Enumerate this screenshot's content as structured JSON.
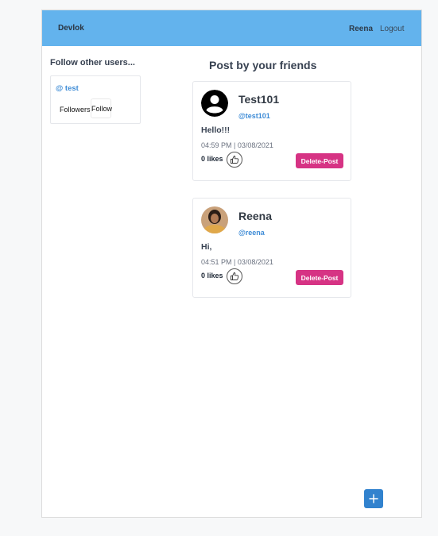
{
  "navbar": {
    "brand": "Devlok",
    "user": "Reena",
    "logout": "Logout",
    "color": "#63b3ed"
  },
  "sidebar": {
    "title": "Follow other users...",
    "suggestions": [
      {
        "handle": "@ test",
        "followers_label": "Followers",
        "follow_label": "Follow"
      }
    ]
  },
  "feed": {
    "title": "Post by your friends",
    "posts": [
      {
        "name": "Test101",
        "handle": "@test101",
        "text": "Hello!!!",
        "time": "04:59 PM | 03/08/2021",
        "likes": "0 likes",
        "delete_label": "Delete-Post",
        "avatar": "default-user-icon"
      },
      {
        "name": "Reena",
        "handle": "@reena",
        "text": "Hi,",
        "time": "04:51 PM | 03/08/2021",
        "likes": "0 likes",
        "delete_label": "Delete-Post",
        "avatar": "user-photo"
      }
    ]
  },
  "fab": {
    "icon": "plus-icon",
    "color": "#3182ce"
  },
  "colors": {
    "accent_link": "#3d8bd6",
    "delete": "#d63384"
  }
}
